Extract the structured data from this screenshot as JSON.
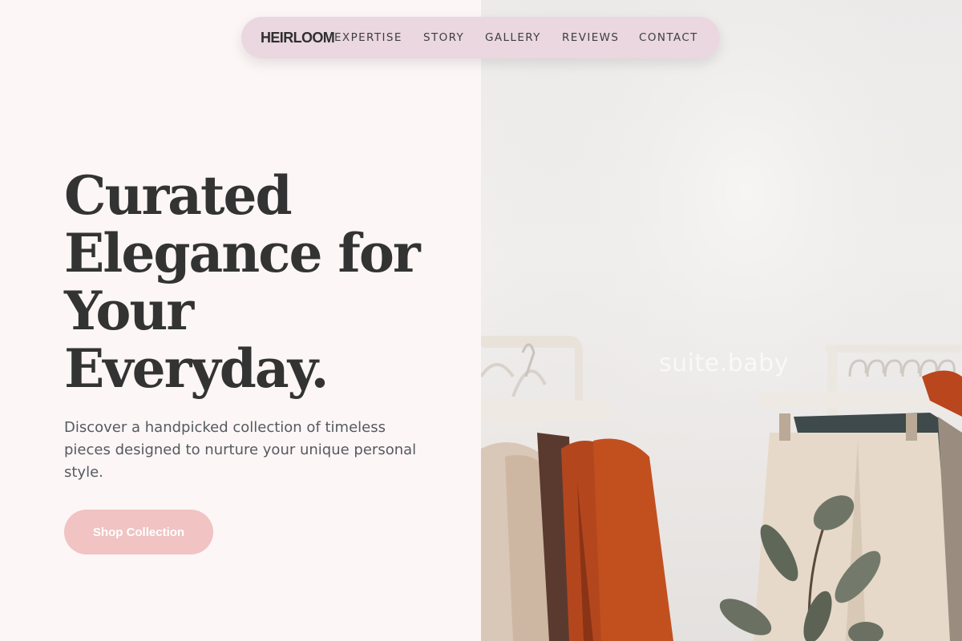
{
  "nav": {
    "brand": "HEIRLOOM",
    "links": [
      "EXPERTISE",
      "STORY",
      "GALLERY",
      "REVIEWS",
      "CONTACT"
    ]
  },
  "hero": {
    "title_lines": [
      "Curated",
      "Elegance for",
      "Your",
      "Everyday."
    ],
    "subtitle": "Discover a handpicked collection of timeless pieces designed to nurture your unique personal style.",
    "cta_label": "Shop Collection"
  },
  "photo": {
    "watermark": "suite.baby"
  },
  "colors": {
    "background": "#fdf6f6",
    "nav_bg": "#e9d6de",
    "cta_bg": "#f1c3c3",
    "title": "#333333",
    "body_text": "#555a60"
  }
}
